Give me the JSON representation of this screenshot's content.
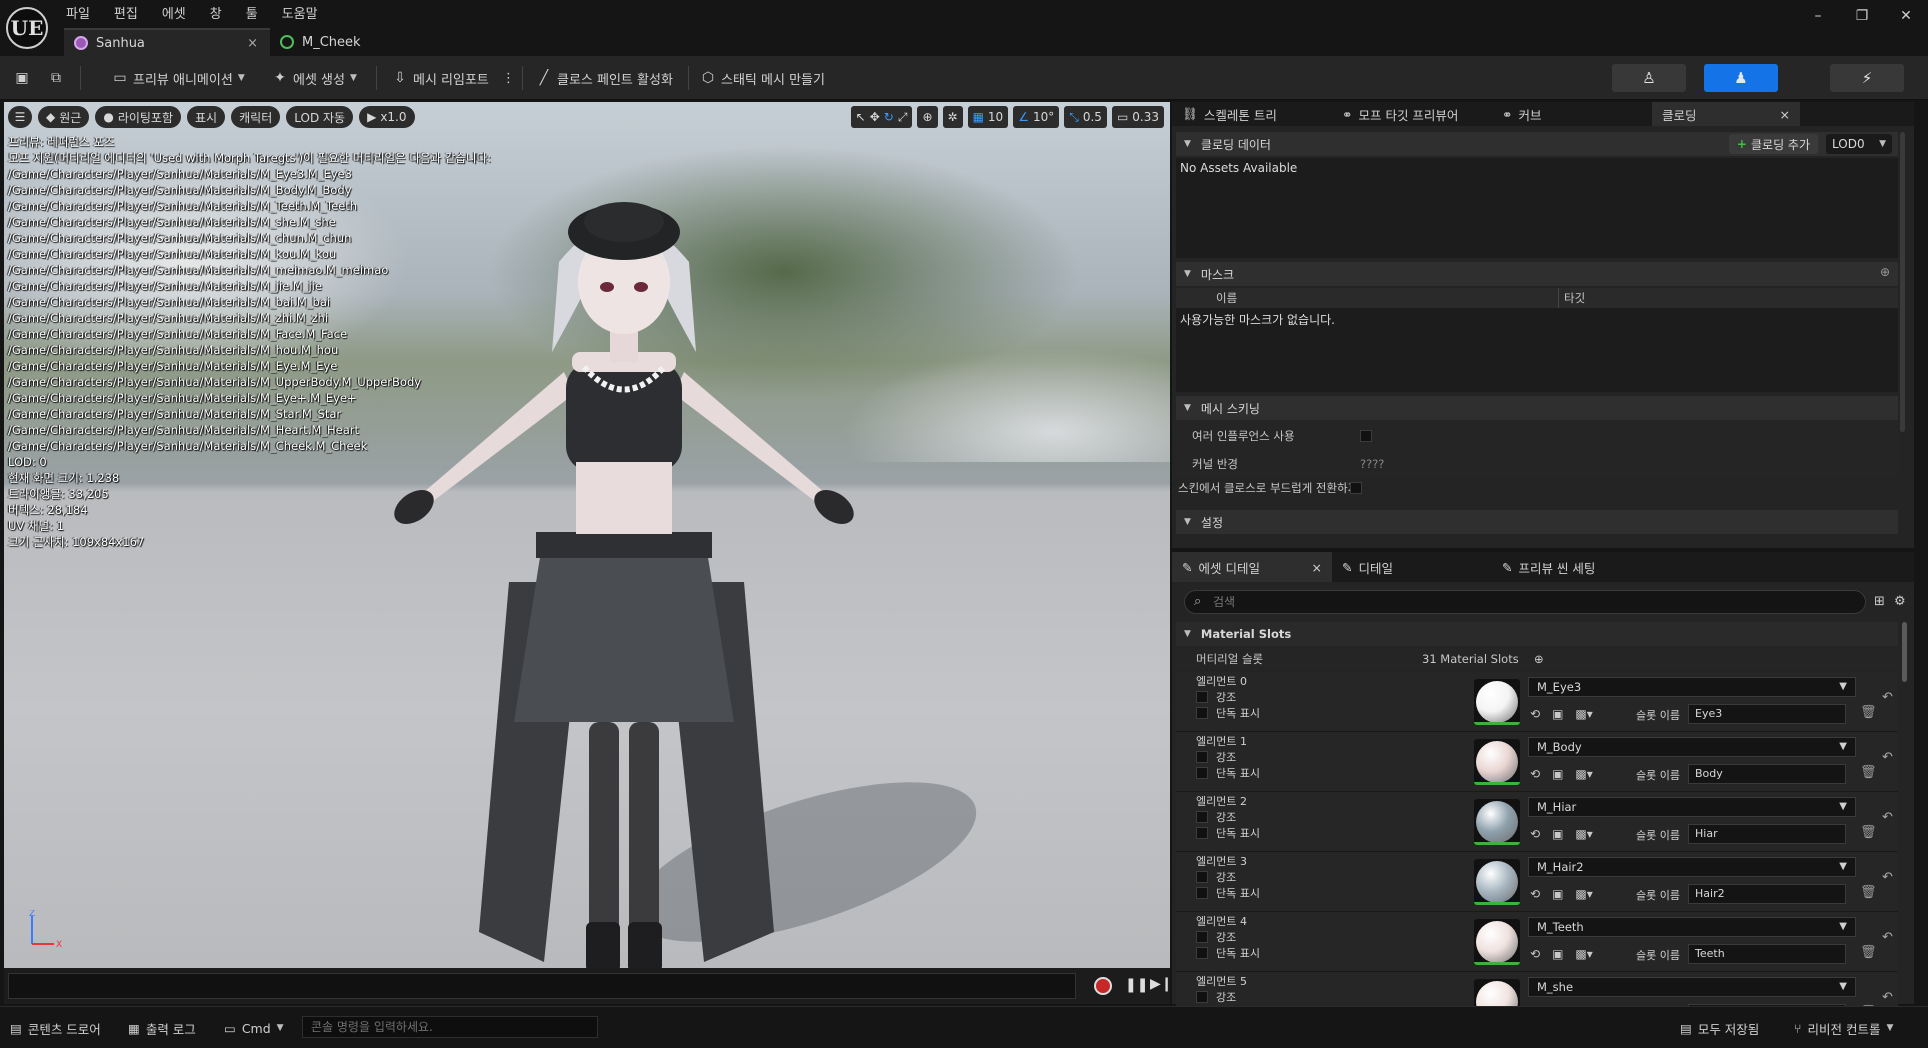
{
  "app": {
    "logo": "UE",
    "menu": [
      "파일",
      "편집",
      "에셋",
      "창",
      "툴",
      "도움말"
    ],
    "tabs": [
      {
        "label": "Sanhua",
        "icon": "skeletal-mesh-icon",
        "close": "×"
      },
      {
        "label": "M_Cheek",
        "icon": "material-icon"
      }
    ],
    "window_controls": [
      "–",
      "❐",
      "✕"
    ]
  },
  "toolbar": {
    "preview_anim": "프리뷰 애니메이션",
    "create_asset": "에셋 생성",
    "mesh_reimport": "메시 리임포트",
    "cloth_paint": "클로스 페인트 활성화",
    "make_static_mesh": "스태틱 메시 만들기",
    "more": "⋮"
  },
  "viewport": {
    "toolbar": {
      "menu": "☰",
      "perspective": "원근",
      "lighting": "라이팅포함",
      "show": "표시",
      "character": "캐릭터",
      "lod": "LOD 자동",
      "speed": "x1.0"
    },
    "snaps": {
      "grid": "10",
      "angle": "10°",
      "scale": "0.5",
      "camera": "0.33"
    },
    "info_lines": [
      "프리뷰: 레퍼런스 포즈",
      "모프 지원(머티리얼 에디터의 'Used with Morph Taregts')이 필요한 머티리얼은 다음과 같습니다:",
      "/Game/Characters/Player/Sanhua/Materials/M_Eye3.M_Eye3",
      "/Game/Characters/Player/Sanhua/Materials/M_Body.M_Body",
      "/Game/Characters/Player/Sanhua/Materials/M_Teeth.M_Teeth",
      "/Game/Characters/Player/Sanhua/Materials/M_she.M_she",
      "/Game/Characters/Player/Sanhua/Materials/M_chun.M_chun",
      "/Game/Characters/Player/Sanhua/Materials/M_kou.M_kou",
      "/Game/Characters/Player/Sanhua/Materials/M_meimao.M_meimao",
      "/Game/Characters/Player/Sanhua/Materials/M_jie.M_jie",
      "/Game/Characters/Player/Sanhua/Materials/M_bai.M_bai",
      "/Game/Characters/Player/Sanhua/Materials/M_zhi.M_zhi",
      "/Game/Characters/Player/Sanhua/Materials/M_Face.M_Face",
      "/Game/Characters/Player/Sanhua/Materials/M_hou.M_hou",
      "/Game/Characters/Player/Sanhua/Materials/M_Eye.M_Eye",
      "/Game/Characters/Player/Sanhua/Materials/M_UpperBody.M_UpperBody",
      "/Game/Characters/Player/Sanhua/Materials/M_Eye+.M_Eye+",
      "/Game/Characters/Player/Sanhua/Materials/M_Star.M_Star",
      "/Game/Characters/Player/Sanhua/Materials/M_Heart.M_Heart",
      "/Game/Characters/Player/Sanhua/Materials/M_Cheek.M_Cheek",
      "LOD: 0",
      "현재 화면 크기: 1.238",
      "트라이앵글: 33,205",
      "버텍스: 28,184",
      "UV 채널: 1",
      "크기 근사치: 109x84x167"
    ],
    "axis": {
      "z": "Z",
      "x": "X"
    }
  },
  "top_panel": {
    "tabs": [
      "스켈레톤 트리",
      "모프 타깃 프리뷰어",
      "커브",
      "클로딩"
    ],
    "close": "×",
    "clothing_data": {
      "title": "클로딩 데이터",
      "add": "클로딩 추가",
      "lod": "LOD0",
      "empty": "No Assets Available"
    },
    "mask": {
      "title": "마스크",
      "col_name": "이름",
      "col_target": "타깃",
      "empty": "사용가능한 마스크가 없습니다."
    },
    "mesh_skinning": {
      "title": "메시 스키닝",
      "multi_influence": "여러 인플루언스 사용",
      "kernel": "커널 반경",
      "kernel_value": "????",
      "smooth_transition": "스킨에서 클로스로 부드럽게 전환하기"
    },
    "settings": "설정"
  },
  "bottom_panel": {
    "tabs": [
      "에셋 디테일",
      "디테일",
      "프리뷰 씬 세팅"
    ],
    "close": "×",
    "search_placeholder": "검색",
    "section": "Material Slots",
    "slots_label": "머티리얼 슬롯",
    "slots_count": "31 Material Slots",
    "highlight": "강조",
    "isolate": "단독 표시",
    "slot_name_label": "슬롯 이름",
    "elements": [
      {
        "label": "엘리먼트 0",
        "material": "M_Eye3",
        "slot": "Eye3",
        "color": "#f4f4f4"
      },
      {
        "label": "엘리먼트 1",
        "material": "M_Body",
        "slot": "Body",
        "color": "#e9d6d2"
      },
      {
        "label": "엘리먼트 2",
        "material": "M_Hiar",
        "slot": "Hiar",
        "color": "#8fa2ae"
      },
      {
        "label": "엘리먼트 3",
        "material": "M_Hair2",
        "slot": "Hair2",
        "color": "#a8b7c2"
      },
      {
        "label": "엘리먼트 4",
        "material": "M_Teeth",
        "slot": "Teeth",
        "color": "#efe2de"
      },
      {
        "label": "엘리먼트 5",
        "material": "M_she",
        "slot": "",
        "color": "#f1e4e0"
      }
    ]
  },
  "statusbar": {
    "content_drawer": "콘텐츠 드로어",
    "output_log": "출력 로그",
    "cmd": "Cmd",
    "console_placeholder": "콘솔 명령을 입력하세요.",
    "save_all": "모두 저장됨",
    "revision_control": "리비전 컨트롤"
  }
}
